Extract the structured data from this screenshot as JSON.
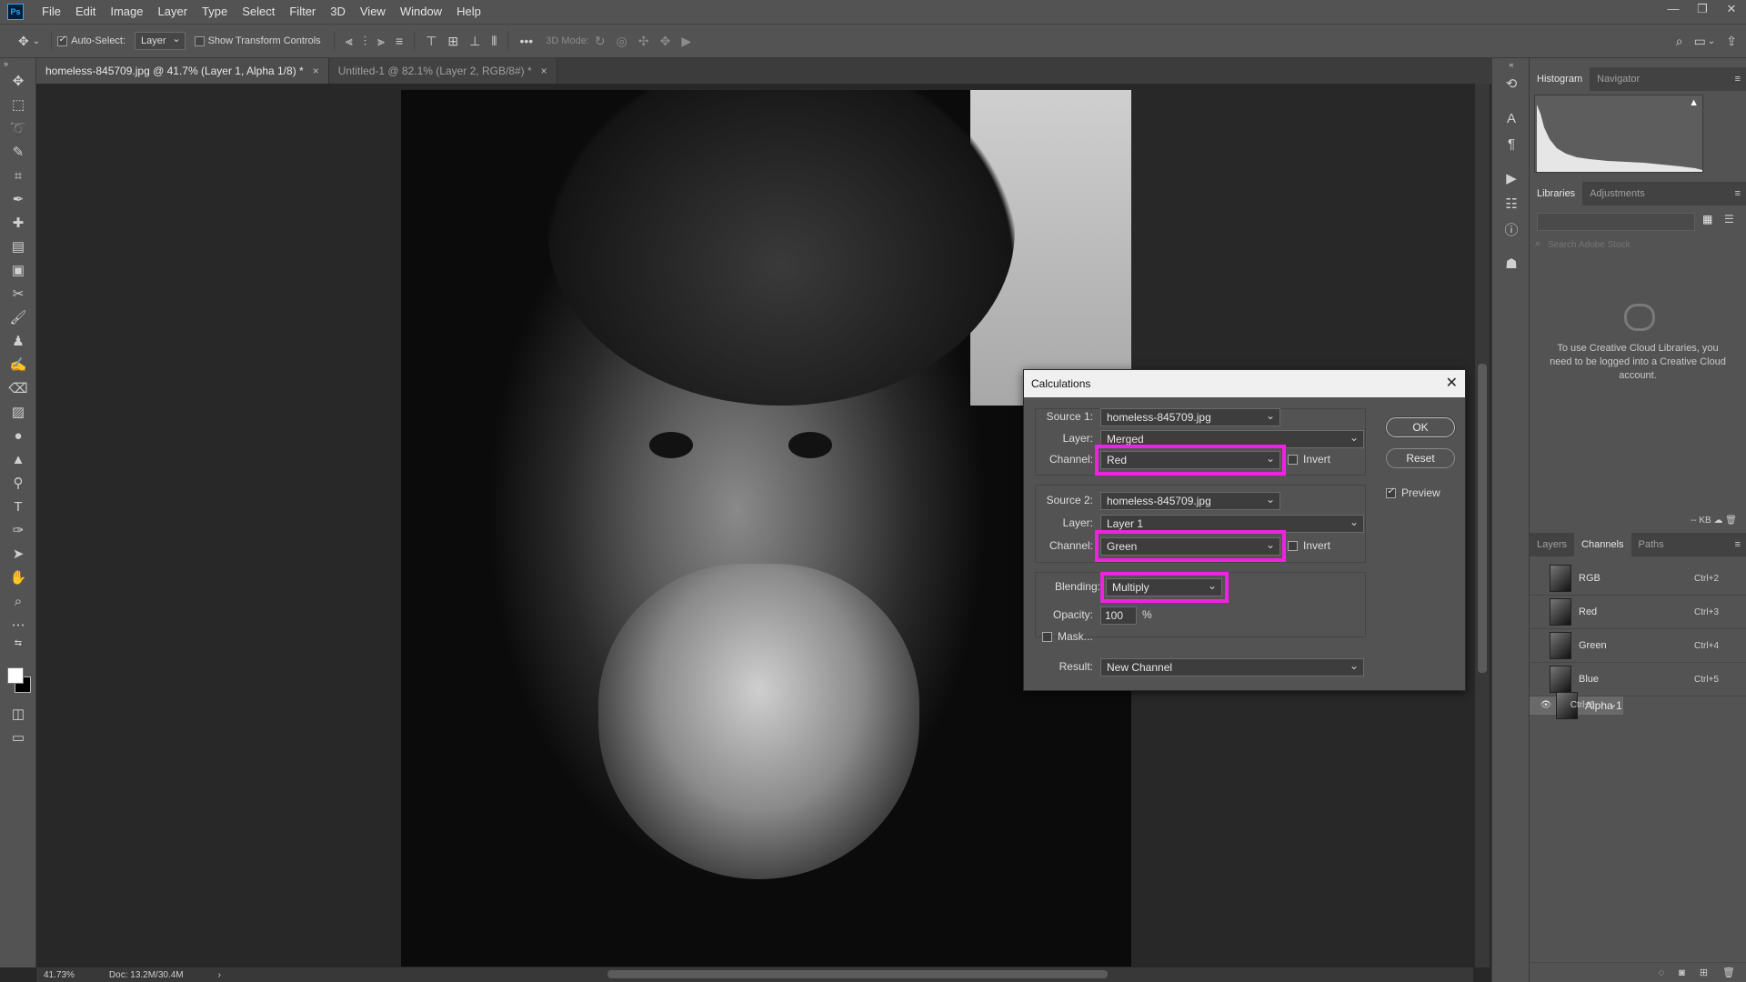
{
  "app": {
    "logo": "Ps",
    "menu": [
      "File",
      "Edit",
      "Image",
      "Layer",
      "Type",
      "Select",
      "Filter",
      "3D",
      "View",
      "Window",
      "Help"
    ],
    "window_controls": [
      "—",
      "❐",
      "✕"
    ]
  },
  "options": {
    "auto_select": "Auto-Select:",
    "auto_select_value": "Layer",
    "show_transform": "Show Transform Controls",
    "mode_3d": "3D Mode:",
    "more": "•••"
  },
  "tabs": [
    {
      "label": "homeless-845709.jpg @ 41.7% (Layer 1, Alpha 1/8) *",
      "close": "×"
    },
    {
      "label": "Untitled-1 @ 82.1% (Layer 2, RGB/8#) *",
      "close": "×"
    }
  ],
  "status": {
    "zoom": "41.73%",
    "doc": "Doc: 13.2M/30.4M"
  },
  "panels": {
    "top_tabs": [
      "Histogram",
      "Navigator"
    ],
    "lib_tabs": [
      "Libraries",
      "Adjustments"
    ],
    "lib_search_placeholder": "Search Adobe Stock",
    "lib_message": "To use Creative Cloud Libraries, you need to be logged into a Creative Cloud account.",
    "lib_kb": "-- KB",
    "layer_tabs": [
      "Layers",
      "Channels",
      "Paths"
    ],
    "channels": [
      {
        "name": "RGB",
        "shortcut": "Ctrl+2"
      },
      {
        "name": "Red",
        "shortcut": "Ctrl+3"
      },
      {
        "name": "Green",
        "shortcut": "Ctrl+4"
      },
      {
        "name": "Blue",
        "shortcut": "Ctrl+5"
      },
      {
        "name": "Alpha 1",
        "shortcut": "Ctrl+6"
      }
    ]
  },
  "dialog": {
    "title": "Calculations",
    "source1": {
      "label": "Source 1:",
      "file": "homeless-845709.jpg",
      "layer_label": "Layer:",
      "layer": "Merged",
      "channel_label": "Channel:",
      "channel": "Red",
      "invert": "Invert"
    },
    "source2": {
      "label": "Source 2:",
      "file": "homeless-845709.jpg",
      "layer_label": "Layer:",
      "layer": "Layer 1",
      "channel_label": "Channel:",
      "channel": "Green",
      "invert": "Invert"
    },
    "blending_label": "Blending:",
    "blending": "Multiply",
    "opacity_label": "Opacity:",
    "opacity": "100",
    "opacity_unit": "%",
    "mask": "Mask...",
    "result_label": "Result:",
    "result": "New Channel",
    "ok": "OK",
    "reset": "Reset",
    "preview": "Preview",
    "highlight_color": "#ef22e3"
  }
}
